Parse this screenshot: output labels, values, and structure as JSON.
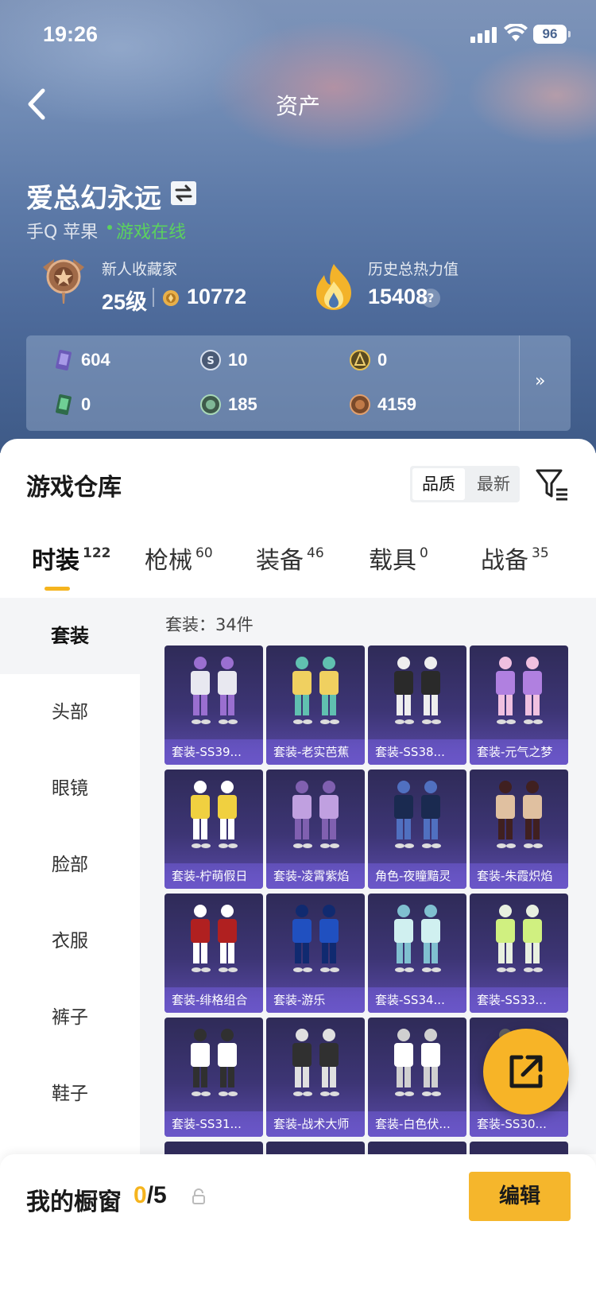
{
  "status_bar": {
    "time": "19:26",
    "battery": "96"
  },
  "nav": {
    "title": "资产"
  },
  "profile": {
    "name": "爱总幻永远",
    "platform": "手Q 苹果",
    "online_status": "游戏在线",
    "rank_title": "新人收藏家",
    "level": "25级",
    "coins": "10772",
    "heat_label": "历史总热力值",
    "heat_value": "15408",
    "help_icon": "?"
  },
  "resources": [
    {
      "icon": "purple-card-icon",
      "value": "604"
    },
    {
      "icon": "silver-coin-icon",
      "value": "10"
    },
    {
      "icon": "gold-token-icon",
      "value": "0"
    },
    {
      "icon": "green-card-icon",
      "value": "0"
    },
    {
      "icon": "green-coin-icon",
      "value": "185"
    },
    {
      "icon": "bronze-coin-icon",
      "value": "4159"
    }
  ],
  "warehouse": {
    "title": "游戏仓库",
    "sort_options": [
      "品质",
      "最新"
    ],
    "sort_selected": "品质",
    "tabs": [
      {
        "label": "时装",
        "count": "122"
      },
      {
        "label": "枪械",
        "count": "60"
      },
      {
        "label": "装备",
        "count": "46"
      },
      {
        "label": "载具",
        "count": "0"
      },
      {
        "label": "战备",
        "count": "35"
      }
    ],
    "active_tab": "时装",
    "categories": [
      "套装",
      "头部",
      "眼镜",
      "脸部",
      "衣服",
      "裤子",
      "鞋子"
    ],
    "active_category": "套装",
    "item_count": "套装：34件",
    "items": [
      "套装-SS39...",
      "套装-老实芭蕉",
      "套装-SS38...",
      "套装-元气之梦",
      "套装-柠萌假日",
      "套装-凌霄紫焰",
      "角色-夜瞳黯灵",
      "套装-朱霞炽焰",
      "套装-绯格组合",
      "套装-游乐",
      "套装-SS34...",
      "套装-SS33...",
      "套装-SS31...",
      "套装-战术大师",
      "套装-白色伏...",
      "套装-SS30..."
    ]
  },
  "showcase": {
    "label": "我的橱窗",
    "current": "0",
    "total": "/5",
    "edit_label": "编辑"
  },
  "colors": {
    "accent": "#f5b41e",
    "card": "#3d3575",
    "online": "#5bd25e"
  }
}
